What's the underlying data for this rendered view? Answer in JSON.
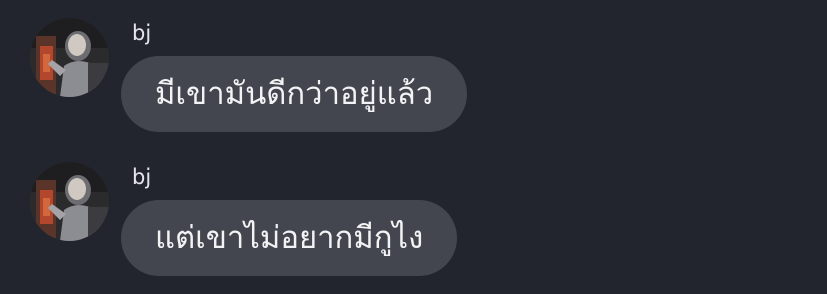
{
  "messages": [
    {
      "sender": "bj",
      "text": "มีเขามันดีกว่าอยู่แล้ว",
      "avatar_icon": "user-avatar-photo"
    },
    {
      "sender": "bj",
      "text": "แต่เขาไม่อยากมีกูไง",
      "avatar_icon": "user-avatar-photo"
    }
  ],
  "colors": {
    "background": "#22252e",
    "bubble": "#43464e",
    "text": "#f2f3f5"
  }
}
